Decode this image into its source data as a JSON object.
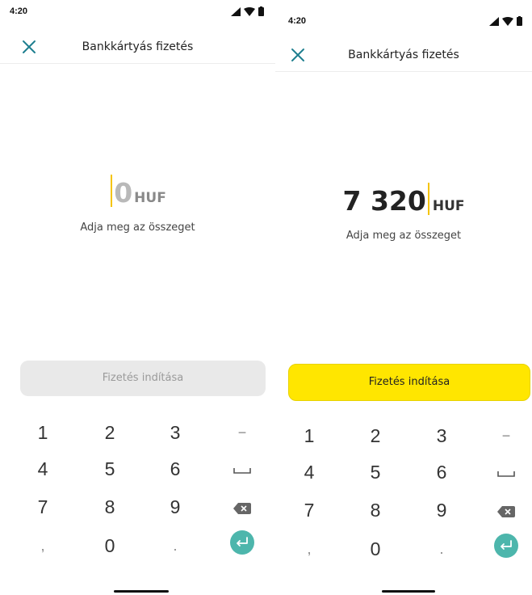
{
  "screens": [
    {
      "status_time": "4:20",
      "title": "Bankkártyás fizetés",
      "amount_value": "0",
      "currency": "HUF",
      "hint": "Adja meg az összeget",
      "pay_button": "Fizetés indítása",
      "keys": [
        "1",
        "2",
        "3",
        "−",
        "4",
        "5",
        "6",
        "␣",
        "7",
        "8",
        "9",
        "⌫",
        ",",
        "0",
        ".",
        "↵"
      ]
    },
    {
      "status_time": "4:20",
      "title": "Bankkártyás fizetés",
      "amount_value": "7 320",
      "currency": "HUF",
      "hint": "Adja meg az összeget",
      "pay_button": "Fizetés indítása",
      "keys": [
        "1",
        "2",
        "3",
        "−",
        "4",
        "5",
        "6",
        "␣",
        "7",
        "8",
        "9",
        "⌫",
        ",",
        "0",
        ".",
        "↵"
      ]
    }
  ],
  "colors": {
    "accent_yellow": "#ffe600",
    "caret_yellow": "#f5c400",
    "teal": "#4db6ac",
    "close_teal": "#1f7f8f"
  },
  "icons": {
    "close": "close-icon",
    "signal": "signal-icon",
    "wifi": "wifi-icon",
    "battery": "battery-icon",
    "space": "space-icon",
    "backspace": "backspace-icon",
    "enter": "enter-icon"
  }
}
